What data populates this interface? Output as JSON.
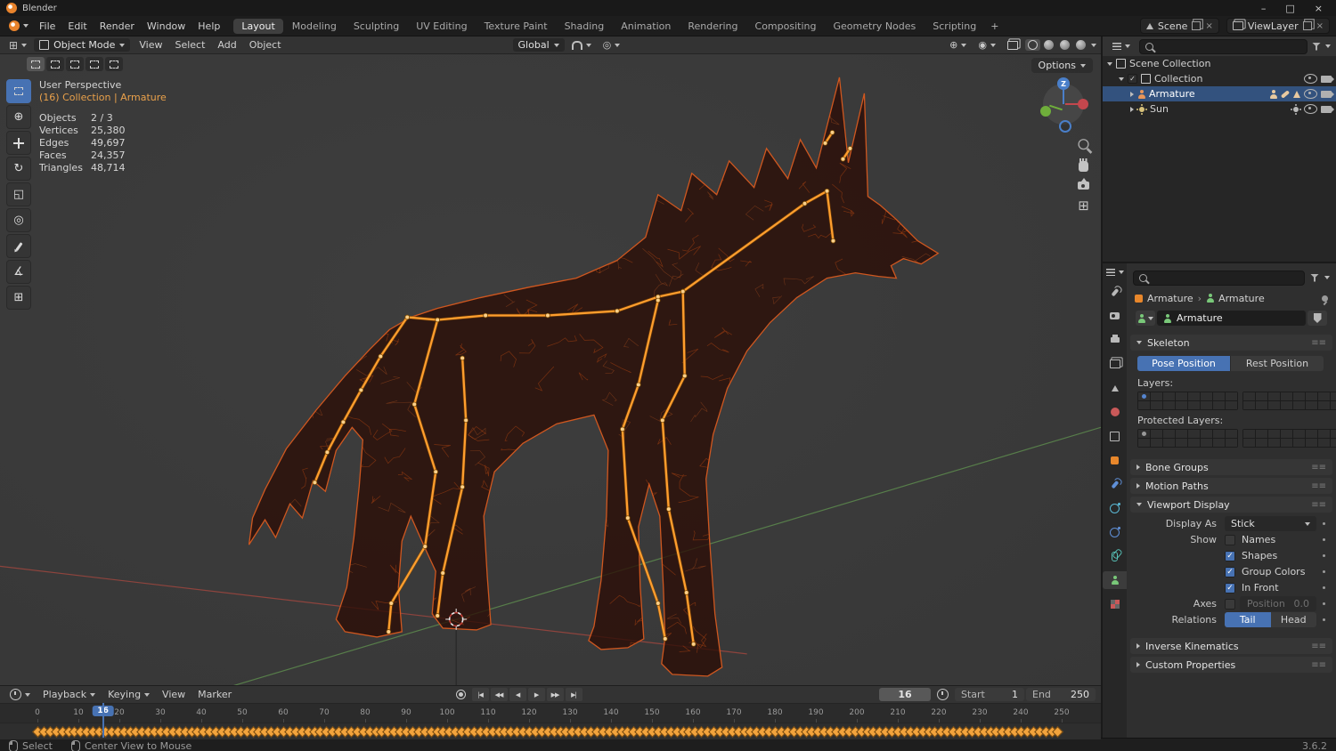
{
  "window": {
    "title": "Blender",
    "minimize": "–",
    "maximize": "□",
    "close": "×"
  },
  "topbar": {
    "app_menus": [
      "File",
      "Edit",
      "Render",
      "Window",
      "Help"
    ],
    "workspaces": [
      "Layout",
      "Modeling",
      "Sculpting",
      "UV Editing",
      "Texture Paint",
      "Shading",
      "Animation",
      "Rendering",
      "Compositing",
      "Geometry Nodes",
      "Scripting"
    ],
    "active_workspace": "Layout",
    "add_workspace_label": "+",
    "scene_field": {
      "value": "Scene"
    },
    "view_layer_field": {
      "value": "ViewLayer"
    }
  },
  "viewport": {
    "header": {
      "mode": "Object Mode",
      "menus": [
        "View",
        "Select",
        "Add",
        "Object"
      ],
      "orientation": "Global",
      "shading_modes": [
        "wireframe",
        "solid",
        "material",
        "rendered"
      ],
      "active_shading": "wireframe"
    },
    "tool_settings": {
      "select_modes": [
        "new",
        "extend",
        "subtract",
        "invert",
        "intersect"
      ],
      "active_mode": "new",
      "options_label": "Options"
    },
    "overlay": {
      "view_label": "User Perspective",
      "context_label": "(16) Collection | Armature",
      "stats": [
        [
          "Objects",
          "2 / 3"
        ],
        [
          "Vertices",
          "25,380"
        ],
        [
          "Edges",
          "49,697"
        ],
        [
          "Faces",
          "24,357"
        ],
        [
          "Triangles",
          "48,714"
        ]
      ]
    },
    "axis_gizmo": {
      "axes": [
        "Z",
        "X",
        "Y"
      ]
    },
    "nav_tools": [
      "zoom",
      "pan",
      "camera-view",
      "toggle-projection"
    ],
    "toolbar": [
      "select-box",
      "cursor",
      "move",
      "rotate",
      "scale",
      "transform",
      "annotate",
      "measure",
      "add-cube"
    ],
    "active_tool": "select-box",
    "armature_bones": {
      "color": "#ff9e2e",
      "chains": [
        [
          [
            458,
            296
          ],
          [
            492,
            299
          ],
          [
            546,
            294
          ],
          [
            616,
            294
          ],
          [
            694,
            289
          ],
          [
            740,
            273
          ],
          [
            768,
            267
          ]
        ],
        [
          [
            768,
            267
          ],
          [
            905,
            168
          ],
          [
            930,
            154
          ]
        ],
        [
          [
            930,
            154
          ],
          [
            937,
            210
          ]
        ],
        [
          [
            928,
            100
          ],
          [
            936,
            88
          ]
        ],
        [
          [
            948,
            118
          ],
          [
            956,
            106
          ]
        ],
        [
          [
            458,
            296
          ],
          [
            428,
            340
          ],
          [
            406,
            378
          ],
          [
            386,
            414
          ],
          [
            368,
            448
          ],
          [
            354,
            482
          ]
        ],
        [
          [
            492,
            299
          ],
          [
            466,
            394
          ],
          [
            490,
            470
          ],
          [
            478,
            554
          ],
          [
            440,
            618
          ],
          [
            437,
            650
          ]
        ],
        [
          [
            520,
            342
          ],
          [
            524,
            412
          ],
          [
            520,
            487
          ],
          [
            498,
            584
          ],
          [
            492,
            632
          ]
        ],
        [
          [
            768,
            267
          ],
          [
            770,
            362
          ],
          [
            745,
            412
          ],
          [
            752,
            512
          ],
          [
            772,
            606
          ],
          [
            780,
            664
          ]
        ],
        [
          [
            740,
            277
          ],
          [
            718,
            372
          ],
          [
            700,
            422
          ],
          [
            706,
            522
          ],
          [
            740,
            618
          ],
          [
            748,
            658
          ]
        ]
      ]
    }
  },
  "outliner": {
    "rows": [
      {
        "label": "Scene Collection",
        "depth": 0,
        "expanded": true,
        "icon": "boxo",
        "icon_color": "#c9c9c9"
      },
      {
        "label": "Collection",
        "depth": 1,
        "expanded": true,
        "icon": "boxo",
        "icon_color": "#c9c9c9",
        "checkbox": true,
        "eye": true,
        "camera": true
      },
      {
        "label": "Armature",
        "depth": 2,
        "icon": "person",
        "icon_color": "#e8965a",
        "selected": true,
        "extra_icons": [
          "person",
          "bone",
          "tri"
        ],
        "eye": true,
        "camera": true
      },
      {
        "label": "Sun",
        "depth": 2,
        "icon": "sun",
        "icon_color": "#d8c27a",
        "extra_icons": [
          "sun"
        ],
        "eye": true,
        "camera": true
      }
    ]
  },
  "properties": {
    "tabs": [
      {
        "name": "tool",
        "shape": "wrench",
        "color": "#b8b8b8"
      },
      {
        "name": "render",
        "shape": "camback",
        "color": "#b8b8b8"
      },
      {
        "name": "output",
        "shape": "print",
        "color": "#b8b8b8"
      },
      {
        "name": "view-layer",
        "shape": "photos",
        "color": "#b8b8b8"
      },
      {
        "name": "scene",
        "shape": "scene",
        "color": "#b8b8b8"
      },
      {
        "name": "world",
        "shape": "globe",
        "color": "#c95959"
      },
      {
        "name": "collection",
        "shape": "boxo",
        "color": "#b8b8b8"
      },
      {
        "name": "object",
        "shape": "objsq",
        "color": "#e8872b"
      },
      {
        "name": "modifiers",
        "shape": "wrench",
        "color": "#5f8fd6"
      },
      {
        "name": "particles",
        "shape": "orbit",
        "color": "#5bb8d4"
      },
      {
        "name": "physics",
        "shape": "orbit",
        "color": "#5f8fd6"
      },
      {
        "name": "object-constraints",
        "shape": "chain",
        "color": "#57c0b6"
      },
      {
        "name": "object-data",
        "shape": "person",
        "color": "#79c879",
        "active": true
      },
      {
        "name": "texture",
        "shape": "checker",
        "color": "#c95959"
      }
    ],
    "breadcrumb": {
      "object": "Armature",
      "data": "Armature"
    },
    "name_value": "Armature",
    "sections": {
      "skeleton": {
        "label": "Skeleton"
      },
      "bone_groups": {
        "label": "Bone Groups"
      },
      "motion_paths": {
        "label": "Motion Paths"
      },
      "viewport_display": {
        "label": "Viewport Display"
      },
      "inverse_kinematics": {
        "label": "Inverse Kinematics"
      },
      "custom_properties": {
        "label": "Custom Properties"
      }
    },
    "skeleton": {
      "pose_button": "Pose Position",
      "rest_button": "Rest Position",
      "active_position": "Pose Position",
      "layers_label": "Layers:",
      "protected_layers_label": "Protected Layers:",
      "layer_groups": 2,
      "layers_per_group": 16,
      "active_layer_index": 0,
      "protected_active_index": 0
    },
    "viewport_display": {
      "display_as_label": "Display As",
      "display_as_value": "Stick",
      "show_label": "Show",
      "show_options": [
        {
          "label": "Names",
          "checked": false
        },
        {
          "label": "Shapes",
          "checked": true
        },
        {
          "label": "Group Colors",
          "checked": true
        },
        {
          "label": "In Front",
          "checked": true
        }
      ],
      "axes_label": "Axes",
      "axes_checked": false,
      "position_label": "Position",
      "position_value": "0.0",
      "relations_label": "Relations",
      "tail_button": "Tail",
      "head_button": "Head",
      "active_relation": "Tail"
    }
  },
  "timeline": {
    "menus": [
      "Playback",
      "Keying",
      "View",
      "Marker"
    ],
    "transport": [
      "jump-to-start",
      "jump-to-prev-keyframe",
      "play-reverse",
      "play",
      "jump-to-next-keyframe",
      "jump-to-end"
    ],
    "current_frame": 16,
    "frame_field_value": "16",
    "start_label": "Start",
    "start_value": "1",
    "end_label": "End",
    "end_value": "250",
    "ruler": {
      "min": 0,
      "max": 250,
      "label_step": 10
    },
    "keyframes": {
      "start": 0,
      "end": 250,
      "step": 1.5
    }
  },
  "status_bar": {
    "select_label": "Select",
    "center_label": "Center View to Mouse",
    "version": "3.6.2"
  }
}
